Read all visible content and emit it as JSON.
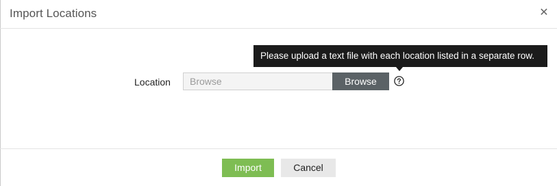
{
  "dialog": {
    "title": "Import Locations",
    "close_glyph": "✕",
    "close_icon": "close-icon"
  },
  "tooltip": {
    "text": "Please upload a text file with each location listed in a separate row."
  },
  "form": {
    "location_label": "Location",
    "file_input_placeholder": "Browse",
    "browse_button_label": "Browse",
    "help_icon": "question-circle-icon"
  },
  "footer": {
    "import_label": "Import",
    "cancel_label": "Cancel"
  },
  "colors": {
    "import_button": "#7ebd53",
    "browse_button": "#5b6266",
    "tooltip_background": "#1b1b1b",
    "cancel_button": "#e8e8e8"
  }
}
